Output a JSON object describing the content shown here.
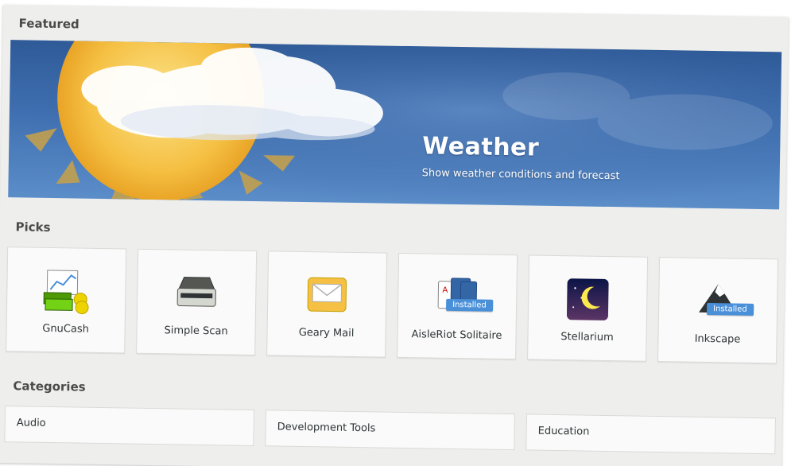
{
  "sections": {
    "featured": "Featured",
    "picks": "Picks",
    "categories": "Categories"
  },
  "featured": {
    "title": "Weather",
    "subtitle": "Show weather conditions and forecast"
  },
  "picks": [
    {
      "label": "GnuCash",
      "icon": "gnucash-icon",
      "badge": ""
    },
    {
      "label": "Simple Scan",
      "icon": "scanner-icon",
      "badge": ""
    },
    {
      "label": "Geary Mail",
      "icon": "mail-icon",
      "badge": ""
    },
    {
      "label": "AisleRiot Solitaire",
      "icon": "cards-icon",
      "badge": "Installed"
    },
    {
      "label": "Stellarium",
      "icon": "night-sky-icon",
      "badge": ""
    },
    {
      "label": "Inkscape",
      "icon": "inkscape-icon",
      "badge": "Installed"
    }
  ],
  "categories": [
    {
      "label": "Audio"
    },
    {
      "label": "Development Tools"
    },
    {
      "label": "Education"
    }
  ],
  "colors": {
    "background": "#eeeeec",
    "banner_blue": "#3f6fb0",
    "badge_blue": "#4a90d9",
    "sun_yellow": "#f5c043"
  }
}
